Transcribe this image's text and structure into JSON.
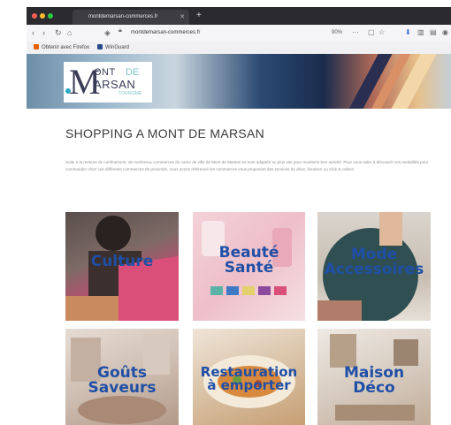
{
  "browser": {
    "tab_title": "montdemarsan-commerces.fr",
    "url": "montdemarsan-commerces.fr",
    "zoom": "90%",
    "bookmarks": [
      "Obtenir avec Firefox",
      "WinGuard"
    ]
  },
  "site": {
    "logo": {
      "m": "M",
      "ont": "ONT",
      "de": "DE",
      "arsan": "ARSAN",
      "tourisme": "TOURISME"
    },
    "title": "SHOPPING A MONT DE MARSAN",
    "intro": "Suite à la mesure de confinement, de nombreux commerces du coeur de ville de Mont de Marsan se sont adaptés au plus vite pour maintenir leur activité. Pour vous aider à découvrir ces modalités pour commander chez ces différents commerces de proximité, nous avons référencé les commerces vous proposant des services de drive, livraison ou click & collect.",
    "tiles": [
      {
        "line1": "Culture",
        "line2": ""
      },
      {
        "line1": "Beauté",
        "line2": "Santé"
      },
      {
        "line1": "Mode",
        "line2": "Accessoires"
      },
      {
        "line1": "Goûts",
        "line2": "Saveurs"
      },
      {
        "line1": "Restauration",
        "line2": "à emporter"
      },
      {
        "line1": "Maison",
        "line2": "Déco"
      }
    ]
  },
  "colors": {
    "label": "#1f4fa6",
    "title": "#3b3b3b"
  }
}
